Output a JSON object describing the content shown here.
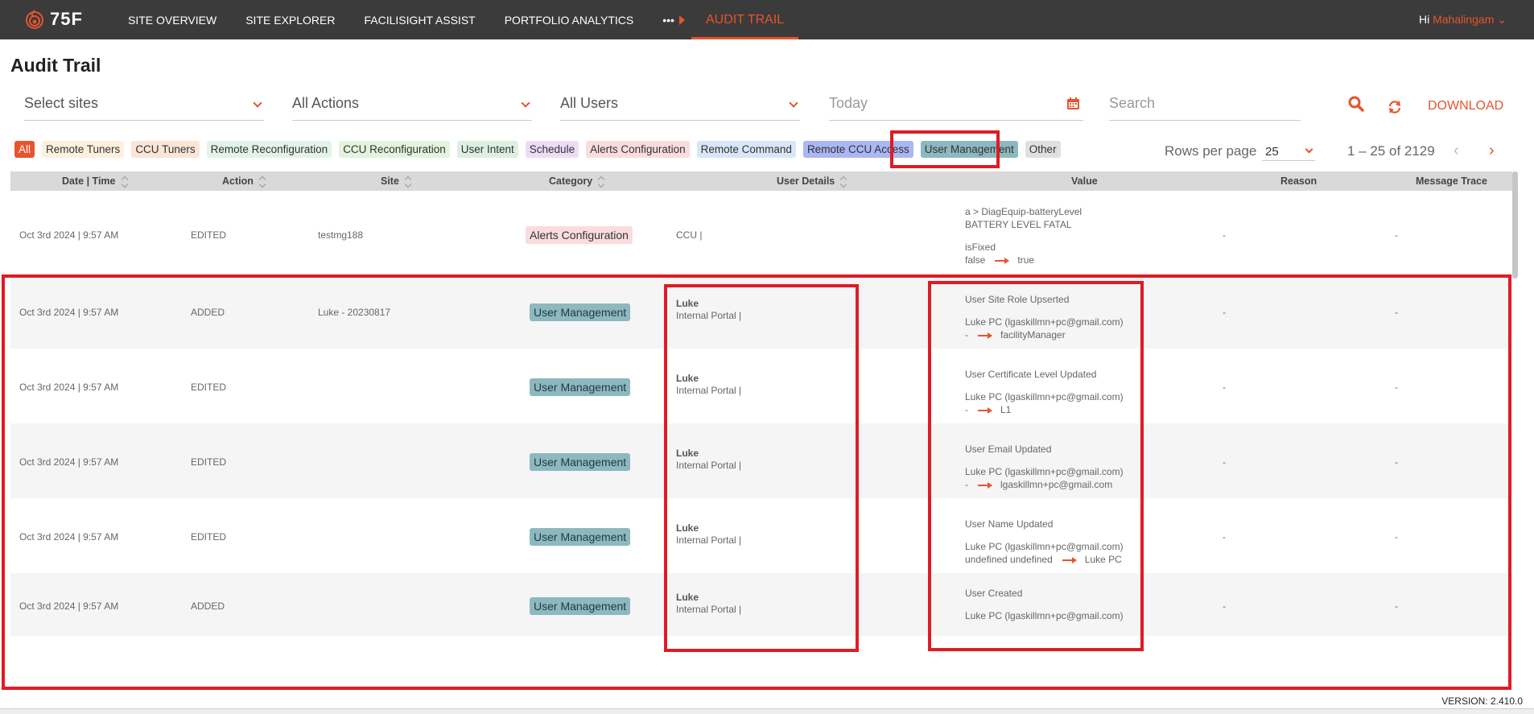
{
  "app": {
    "logo_text": "75F",
    "greeting": "Hi",
    "user_name": "Mahalingam"
  },
  "nav": {
    "items": [
      "SITE OVERVIEW",
      "SITE EXPLORER",
      "FACILISIGHT ASSIST",
      "PORTFOLIO ANALYTICS"
    ],
    "more": "•••",
    "active": "AUDIT TRAIL"
  },
  "page": {
    "title": "Audit Trail"
  },
  "filters": {
    "sites": "Select sites",
    "actions": "All Actions",
    "users": "All Users",
    "date": "Today",
    "search": "Search",
    "download": "DOWNLOAD"
  },
  "chips": [
    {
      "label": "All",
      "bg": "#e8542c",
      "fg": "#ffffff"
    },
    {
      "label": "Remote Tuners",
      "bg": "#fdf0dc"
    },
    {
      "label": "CCU Tuners",
      "bg": "#fbe5d6"
    },
    {
      "label": "Remote Reconfiguration",
      "bg": "#e2f3ea"
    },
    {
      "label": "CCU Reconfiguration",
      "bg": "#e3f3dc"
    },
    {
      "label": "User Intent",
      "bg": "#dcf0e2"
    },
    {
      "label": "Schedule",
      "bg": "#eedcf7"
    },
    {
      "label": "Alerts Configuration",
      "bg": "#fbdcdc"
    },
    {
      "label": "Remote Command",
      "bg": "#d8e6f8"
    },
    {
      "label": "Remote CCU Access",
      "bg": "#a9b7f2"
    },
    {
      "label": "User Management",
      "bg": "#8db8bf"
    },
    {
      "label": "Other",
      "bg": "#e0e0e0"
    }
  ],
  "pagination": {
    "rows_label": "Rows per page",
    "rows_value": "25",
    "range": "1 – 25 of 2129"
  },
  "columns": [
    "Date | Time",
    "Action",
    "Site",
    "Category",
    "User Details",
    "Value",
    "Reason",
    "Message Trace"
  ],
  "rows": [
    {
      "date": "Oct 3rd 2024 | 9:57 AM",
      "action": "EDITED",
      "site": "testmg188",
      "category": "Alerts Configuration",
      "user_name": "",
      "user_sub": "CCU |",
      "value_title": "a > DiagEquip-batteryLevel",
      "value_line2": "BATTERY LEVEL FATAL",
      "value_line3": "isFixed",
      "value_from": "false",
      "value_to": "true",
      "reason": "-",
      "trace": "-"
    },
    {
      "date": "Oct 3rd 2024 | 9:57 AM",
      "action": "ADDED",
      "site": "Luke - 20230817",
      "category": "User Management",
      "user_name": "Luke",
      "user_sub": "Internal Portal |",
      "value_title": "User Site Role Upserted",
      "value_line2": "Luke PC (lgaskillmn+pc@gmail.com)",
      "value_from": "-",
      "value_to": "facilityManager",
      "reason": "-",
      "trace": "-"
    },
    {
      "date": "Oct 3rd 2024 | 9:57 AM",
      "action": "EDITED",
      "site": "",
      "category": "User Management",
      "user_name": "Luke",
      "user_sub": "Internal Portal |",
      "value_title": "User Certificate Level Updated",
      "value_line2": "Luke PC (lgaskillmn+pc@gmail.com)",
      "value_from": "-",
      "value_to": "L1",
      "reason": "-",
      "trace": "-"
    },
    {
      "date": "Oct 3rd 2024 | 9:57 AM",
      "action": "EDITED",
      "site": "",
      "category": "User Management",
      "user_name": "Luke",
      "user_sub": "Internal Portal |",
      "value_title": "User Email Updated",
      "value_line2": "Luke PC (lgaskillmn+pc@gmail.com)",
      "value_from": "-",
      "value_to": "lgaskillmn+pc@gmail.com",
      "reason": "-",
      "trace": "-"
    },
    {
      "date": "Oct 3rd 2024 | 9:57 AM",
      "action": "EDITED",
      "site": "",
      "category": "User Management",
      "user_name": "Luke",
      "user_sub": "Internal Portal |",
      "value_title": "User Name Updated",
      "value_line2": "Luke PC (lgaskillmn+pc@gmail.com)",
      "value_from": "undefined undefined",
      "value_to": "Luke PC",
      "reason": "-",
      "trace": "-"
    },
    {
      "date": "Oct 3rd 2024 | 9:57 AM",
      "action": "ADDED",
      "site": "",
      "category": "User Management",
      "user_name": "Luke",
      "user_sub": "Internal Portal |",
      "value_title": "User Created",
      "value_line2": "Luke PC (lgaskillmn+pc@gmail.com)",
      "reason": "-",
      "trace": "-"
    }
  ],
  "category_colors": {
    "Alerts Configuration": "#fbdcdc",
    "User Management": "#8db8bf"
  },
  "footer": {
    "version": "VERSION: 2.410.0"
  }
}
